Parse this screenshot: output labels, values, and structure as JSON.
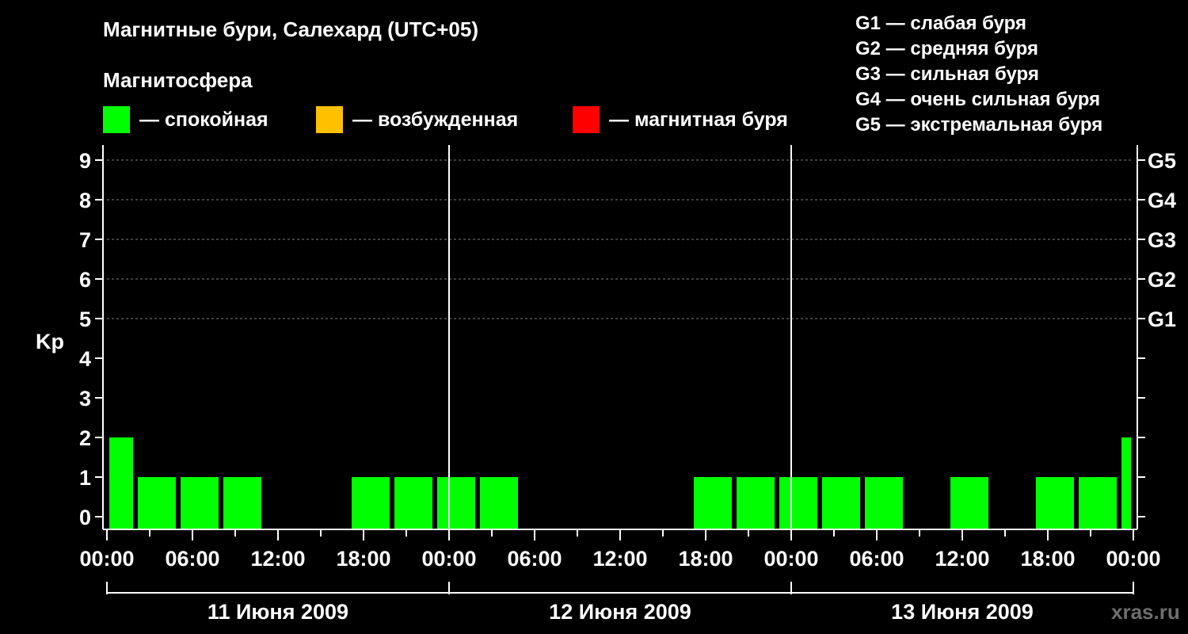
{
  "header": {
    "title": "Магнитные бури, Салехард (UTC+05)",
    "magnetosphere_label": "Магнитосфера",
    "legend": [
      {
        "label": "— спокойная",
        "color": "#00ff00"
      },
      {
        "label": "— возбужденная",
        "color": "#ffc000"
      },
      {
        "label": "— магнитная буря",
        "color": "#ff0000"
      }
    ],
    "g_scale": [
      "G1 — слабая буря",
      "G2 — средняя буря",
      "G3 — сильная буря",
      "G4 — очень сильная буря",
      "G5 — экстремальная буря"
    ]
  },
  "watermark": "xras.ru",
  "chart_data": {
    "type": "bar",
    "ylabel": "Kp",
    "ylim": [
      0,
      9
    ],
    "yticks": [
      "0",
      "1",
      "2",
      "3",
      "4",
      "5",
      "6",
      "7",
      "8",
      "9"
    ],
    "right_ticks": [
      {
        "kp": 5,
        "label": "G1"
      },
      {
        "kp": 6,
        "label": "G2"
      },
      {
        "kp": 7,
        "label": "G3"
      },
      {
        "kp": 8,
        "label": "G4"
      },
      {
        "kp": 9,
        "label": "G5"
      }
    ],
    "xtick_labels": [
      "00:00",
      "06:00",
      "12:00",
      "18:00",
      "00:00",
      "06:00",
      "12:00",
      "18:00",
      "00:00",
      "06:00",
      "12:00",
      "18:00",
      "00:00"
    ],
    "days": [
      "11 Июня 2009",
      "12 Июня 2009",
      "13 Июня 2009"
    ],
    "bar_color": "#00ff00",
    "bars": [
      {
        "day": 0,
        "start_hour": 0,
        "end_hour": 2,
        "kp": 2
      },
      {
        "day": 0,
        "start_hour": 2,
        "end_hour": 5,
        "kp": 1
      },
      {
        "day": 0,
        "start_hour": 5,
        "end_hour": 8,
        "kp": 1
      },
      {
        "day": 0,
        "start_hour": 8,
        "end_hour": 11,
        "kp": 1
      },
      {
        "day": 0,
        "start_hour": 11,
        "end_hour": 14,
        "kp": 0
      },
      {
        "day": 0,
        "start_hour": 14,
        "end_hour": 17,
        "kp": 0
      },
      {
        "day": 0,
        "start_hour": 17,
        "end_hour": 20,
        "kp": 1
      },
      {
        "day": 0,
        "start_hour": 20,
        "end_hour": 23,
        "kp": 1
      },
      {
        "day": 0,
        "start_hour": 23,
        "end_hour": 26,
        "kp": 1
      },
      {
        "day": 0,
        "start_hour": 26,
        "end_hour": 29,
        "kp": 1
      },
      {
        "day": 1,
        "start_hour": 5,
        "end_hour": 8,
        "kp": 0
      },
      {
        "day": 1,
        "start_hour": 8,
        "end_hour": 11,
        "kp": 0
      },
      {
        "day": 1,
        "start_hour": 11,
        "end_hour": 14,
        "kp": 0
      },
      {
        "day": 1,
        "start_hour": 14,
        "end_hour": 17,
        "kp": 0
      },
      {
        "day": 1,
        "start_hour": 17,
        "end_hour": 20,
        "kp": 1
      },
      {
        "day": 1,
        "start_hour": 20,
        "end_hour": 23,
        "kp": 1
      },
      {
        "day": 1,
        "start_hour": 23,
        "end_hour": 26,
        "kp": 1
      },
      {
        "day": 1,
        "start_hour": 26,
        "end_hour": 29,
        "kp": 1
      },
      {
        "day": 2,
        "start_hour": 5,
        "end_hour": 8,
        "kp": 1
      },
      {
        "day": 2,
        "start_hour": 8,
        "end_hour": 11,
        "kp": 0
      },
      {
        "day": 2,
        "start_hour": 11,
        "end_hour": 14,
        "kp": 1
      },
      {
        "day": 2,
        "start_hour": 14,
        "end_hour": 17,
        "kp": 0
      },
      {
        "day": 2,
        "start_hour": 17,
        "end_hour": 20,
        "kp": 1
      },
      {
        "day": 2,
        "start_hour": 20,
        "end_hour": 23,
        "kp": 1
      },
      {
        "day": 2,
        "start_hour": 23,
        "end_hour": 24,
        "kp": 2
      }
    ]
  }
}
